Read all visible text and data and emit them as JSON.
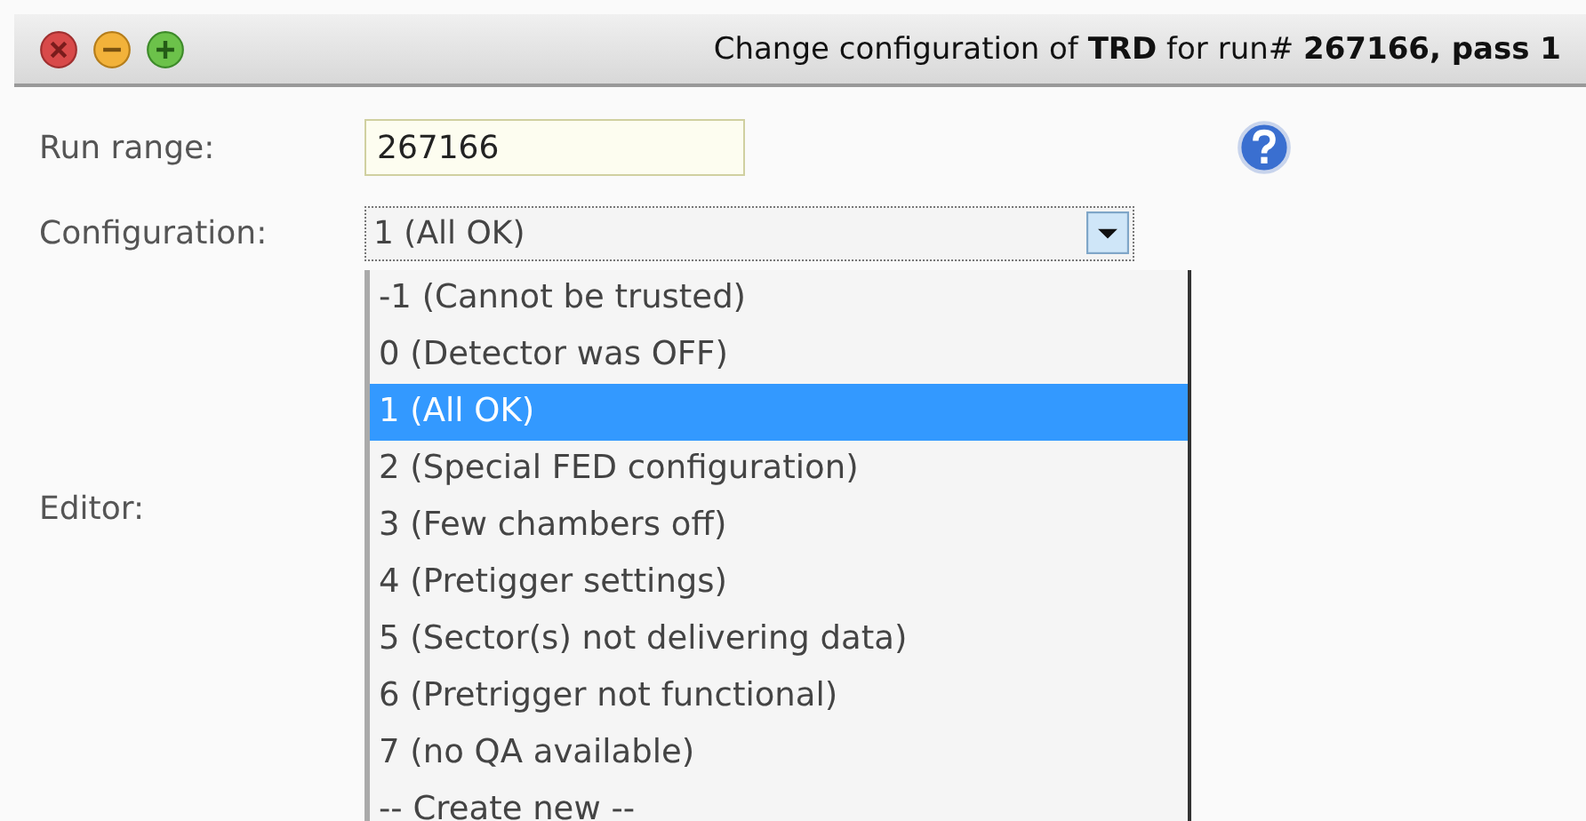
{
  "window": {
    "title": "Change configuration of **TRD** for run# **267166, pass 1**"
  },
  "form": {
    "run_range": {
      "label": "Run range:",
      "value": "267166"
    },
    "configuration": {
      "label": "Configuration:",
      "value": "1 (All OK)",
      "expanded": true,
      "options": [
        {
          "label": "-1 (Cannot be trusted)",
          "selected": false
        },
        {
          "label": "0 (Detector was OFF)",
          "selected": false
        },
        {
          "label": "1 (All OK)",
          "selected": true
        },
        {
          "label": "2 (Special FED configuration)",
          "selected": false
        },
        {
          "label": "3 (Few chambers off)",
          "selected": false
        },
        {
          "label": "4 (Pretigger settings)",
          "selected": false
        },
        {
          "label": "5 (Sector(s) not delivering data)",
          "selected": false
        },
        {
          "label": "6 (Pretrigger not functional)",
          "selected": false
        },
        {
          "label": "7 (no QA available)",
          "selected": false
        },
        {
          "label": "-- Create new --",
          "selected": false
        }
      ]
    },
    "editor": {
      "label": "Editor:"
    }
  }
}
